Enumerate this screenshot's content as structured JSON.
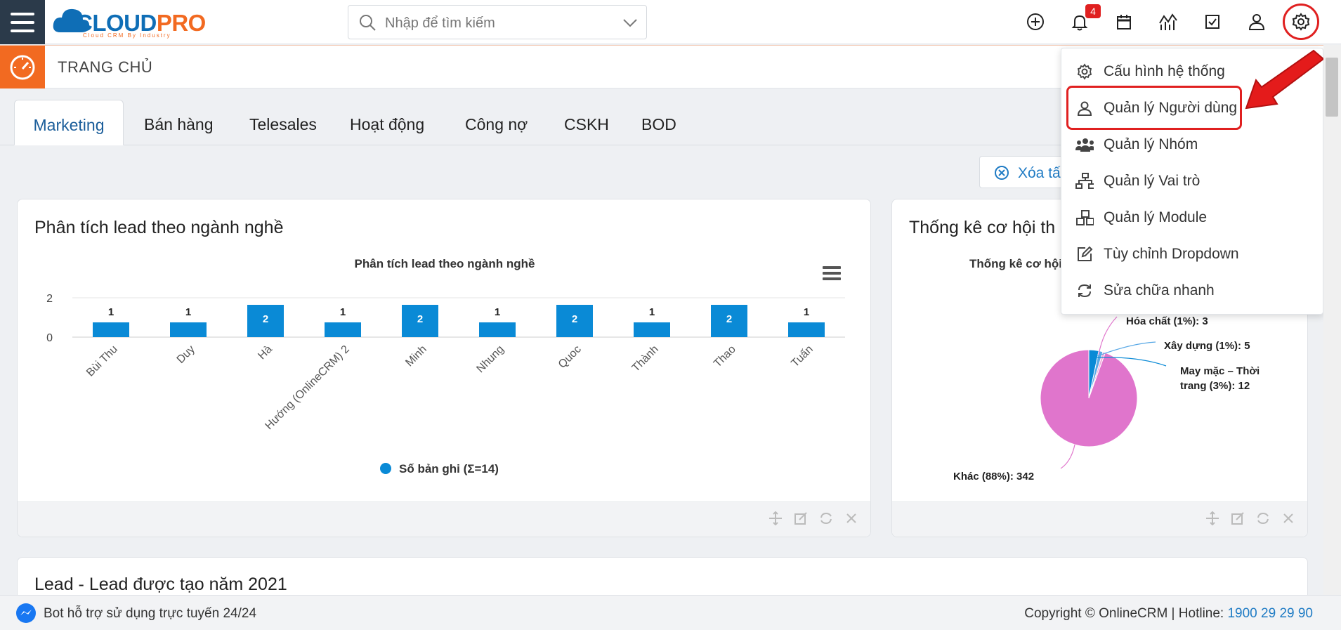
{
  "header": {
    "logo": {
      "cloud": "CLOUD",
      "pro": "PRO",
      "tagline": "Cloud CRM By Industry"
    },
    "search": {
      "placeholder": "Nhập để tìm kiếm"
    },
    "notification_count": "4",
    "icons": [
      "plus-circle-icon",
      "bell-icon",
      "calendar-icon",
      "chart-icon",
      "checkbox-icon",
      "user-icon",
      "gear-icon"
    ]
  },
  "subheader": {
    "title": "TRANG CHỦ"
  },
  "tabs": [
    {
      "label": "Marketing",
      "active": true
    },
    {
      "label": "Bán hàng"
    },
    {
      "label": "Telesales"
    },
    {
      "label": "Hoạt động"
    },
    {
      "label": "Công nợ"
    },
    {
      "label": "CSKH"
    },
    {
      "label": "BOD"
    }
  ],
  "clear_button": {
    "label": "Xóa tấ"
  },
  "settings_menu": {
    "items": [
      {
        "label": "Cấu hình hệ thống",
        "icon": "gear-icon"
      },
      {
        "label": "Quản lý Người dùng",
        "icon": "user-icon"
      },
      {
        "label": "Quản lý Nhóm",
        "icon": "users-group-icon"
      },
      {
        "label": "Quản lý Vai trò",
        "icon": "sitemap-icon"
      },
      {
        "label": "Quản lý Module",
        "icon": "cubes-icon"
      },
      {
        "label": "Tùy chỉnh Dropdown",
        "icon": "edit-icon"
      },
      {
        "label": "Sửa chữa nhanh",
        "icon": "refresh-icon"
      }
    ]
  },
  "cards": {
    "lead_industry": {
      "title": "Phân tích lead theo ngành nghề"
    },
    "opportunity": {
      "title": "Thống kê cơ hội th"
    },
    "lead_2021": {
      "title": "Lead - Lead được tạo năm 2021"
    }
  },
  "chart_data": [
    {
      "type": "bar",
      "title": "Phân tích lead theo ngành nghề",
      "categories": [
        "Bùi Thu",
        "Duy",
        "Hà",
        "Hướng (OnlineCRM) 2",
        "Minh",
        "Nhung",
        "Quoc",
        "Thành",
        "Thao",
        "Tuấn"
      ],
      "series": [
        {
          "name": "Số bản ghi (Σ=14)",
          "values": [
            1,
            1,
            2,
            1,
            2,
            1,
            2,
            1,
            2,
            1
          ]
        }
      ],
      "y_ticks": [
        "0",
        "2"
      ],
      "ylim": [
        0,
        2
      ],
      "color": "#0a8ad6",
      "legend": "bottom"
    },
    {
      "type": "pie",
      "title": "Thống kê cơ hội",
      "slices": [
        {
          "label": "Khác (88%): 342",
          "value": 342,
          "color": "#e075cc"
        },
        {
          "label": "Hóa chất (1%): 3",
          "value": 3,
          "color": "#f2a6d9"
        },
        {
          "label": "Xây dựng (1%): 5",
          "value": 5,
          "color": "#5aa9e6"
        },
        {
          "label": "May mặc – Thời",
          "label2": "trang (3%): 12",
          "value": 12,
          "color": "#0a8ad6"
        }
      ]
    }
  ],
  "footer": {
    "bot_text": "Bot hỗ trợ sử dụng trực tuyến 24/24",
    "copyright": "Copyright © OnlineCRM | Hotline: ",
    "hotline": "1900 29 29 90"
  },
  "colors": {
    "brand_blue": "#0f6eb6",
    "brand_orange": "#f26a21",
    "highlight_red": "#e02020"
  }
}
